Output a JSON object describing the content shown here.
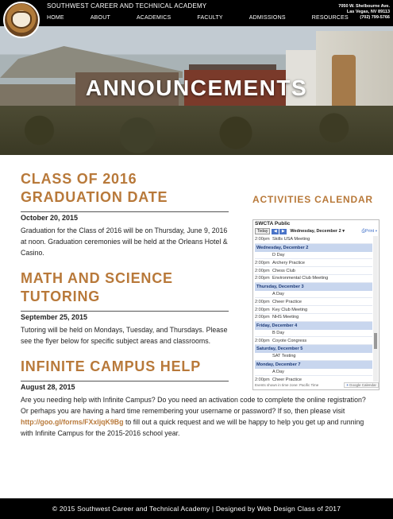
{
  "header": {
    "school_name": "SOUTHWEST CAREER AND TECHNICAL ACADEMY",
    "nav": [
      "HOME",
      "ABOUT",
      "ACADEMICS",
      "FACULTY",
      "ADMISSIONS",
      "RESOURCES"
    ],
    "address_line1": "7050 W. Shelbourne Ave.",
    "address_line2": "Las Vegas, NV 89113",
    "phone": "(702) 799-5766"
  },
  "hero": {
    "title": "ANNOUNCEMENTS"
  },
  "posts": [
    {
      "title_line1": "CLASS OF 2016",
      "title_line2": "GRADUATION DATE",
      "date": "October 20, 2015",
      "body": "Graduation for the Class of 2016 will be on Thursday, June 9, 2016 at noon. Graduation ceremonies will be held at the Orleans Hotel & Casino."
    },
    {
      "title_line1": "MATH AND SCIENCE",
      "title_line2": "TUTORING",
      "date": "September 25, 2015",
      "body": "Tutoring will be held on Mondays, Tuesday, and Thursdays. Please see the flyer below for specific subject areas and classrooms."
    },
    {
      "title_line1": "INFINITE CAMPUS HELP",
      "date": "August 28, 2015",
      "body_before": "Are you needing help with Infinite Campus? Do you need an activation code to complete the online registration? Or perhaps you are having a hard time remembering your username or password? If so, then please visit ",
      "link": "http://goo.gl/forms/FXxljqK9Bg",
      "body_after": " to fill out a quick request and we will be happy to help you get up and running with Infinite Campus for the 2015-2016 school year."
    }
  ],
  "sidebar": {
    "title": "ACTIVITIES CALENDAR",
    "calendar": {
      "name": "SWCTA Public",
      "today": "Today",
      "range": "Wednesday, December 2",
      "print": "Print",
      "rows": [
        {
          "kind": "event",
          "time": "2:00pm",
          "text": "Skills USA Meeting"
        },
        {
          "kind": "day",
          "text": "Wednesday, December 2"
        },
        {
          "kind": "event",
          "time": "",
          "text": "D Day"
        },
        {
          "kind": "event",
          "time": "2:00pm",
          "text": "Archery Practice"
        },
        {
          "kind": "event",
          "time": "2:00pm",
          "text": "Chess Club"
        },
        {
          "kind": "event",
          "time": "2:00pm",
          "text": "Environmental Club Meeting"
        },
        {
          "kind": "day",
          "text": "Thursday, December 3"
        },
        {
          "kind": "event",
          "time": "",
          "text": "A Day"
        },
        {
          "kind": "event",
          "time": "2:00pm",
          "text": "Cheer Practice"
        },
        {
          "kind": "event",
          "time": "2:00pm",
          "text": "Key Club Meeting"
        },
        {
          "kind": "event",
          "time": "2:00pm",
          "text": "NHS Meeting"
        },
        {
          "kind": "day",
          "text": "Friday, December 4"
        },
        {
          "kind": "event",
          "time": "",
          "text": "B Day"
        },
        {
          "kind": "event",
          "time": "2:00pm",
          "text": "Coyote Congress"
        },
        {
          "kind": "day",
          "text": "Saturday, December 5"
        },
        {
          "kind": "event",
          "time": "",
          "text": "SAT Testing"
        },
        {
          "kind": "day",
          "text": "Monday, December 7"
        },
        {
          "kind": "event",
          "time": "",
          "text": "A Day"
        },
        {
          "kind": "event",
          "time": "2:00pm",
          "text": "Cheer Practice"
        }
      ],
      "footer_note": "Events shown in time zone: Pacific Time",
      "badge": "Google Calendar"
    }
  },
  "footer": {
    "text": "© 2015 Southwest Career and Technical Academy | Designed by Web Design Class of 2017"
  }
}
